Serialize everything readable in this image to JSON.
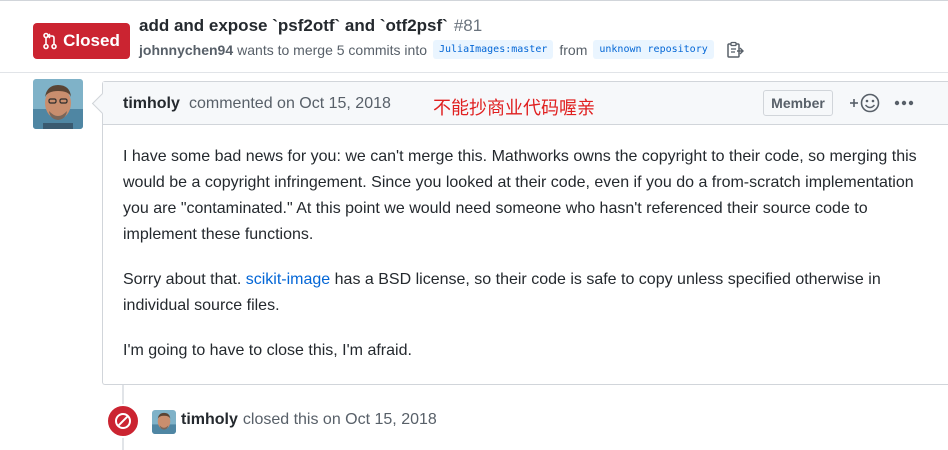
{
  "pull_request": {
    "state_label": "Closed",
    "title": "add and expose `psf2otf` and `otf2psf`",
    "number": "#81",
    "author": "johnnychen94",
    "merge_text": "wants to merge 5 commits into",
    "base_branch": "JuliaImages:master",
    "from_text": "from",
    "head_branch": "unknown repository"
  },
  "comment": {
    "author": "timholy",
    "action": "commented on Oct 15, 2018",
    "annotation": "不能抄商业代码喔亲",
    "role_badge": "Member",
    "body_p1": "I have some bad news for you: we can't merge this. Mathworks owns the copyright to their code, so merging this would be a copyright infringement. Since you looked at their code, even if you do a from-scratch implementation you are \"contaminated.\" At this point we would need someone who hasn't referenced their source code to implement these functions.",
    "body_p2_prefix": "Sorry about that. ",
    "body_p2_link": "scikit-image",
    "body_p2_suffix": " has a BSD license, so their code is safe to copy unless specified otherwise in individual source files.",
    "body_p3": "I'm going to have to close this, I'm afraid."
  },
  "event": {
    "actor": "timholy",
    "text": "closed this on Oct 15, 2018"
  },
  "colors": {
    "closed_red": "#cb2431",
    "link_blue": "#0366d6",
    "annotation_red": "#e02020"
  },
  "icons": [
    "git-pull-request-icon",
    "clipboard-icon",
    "smiley-add-icon",
    "kebab-icon",
    "circle-slash-icon"
  ]
}
